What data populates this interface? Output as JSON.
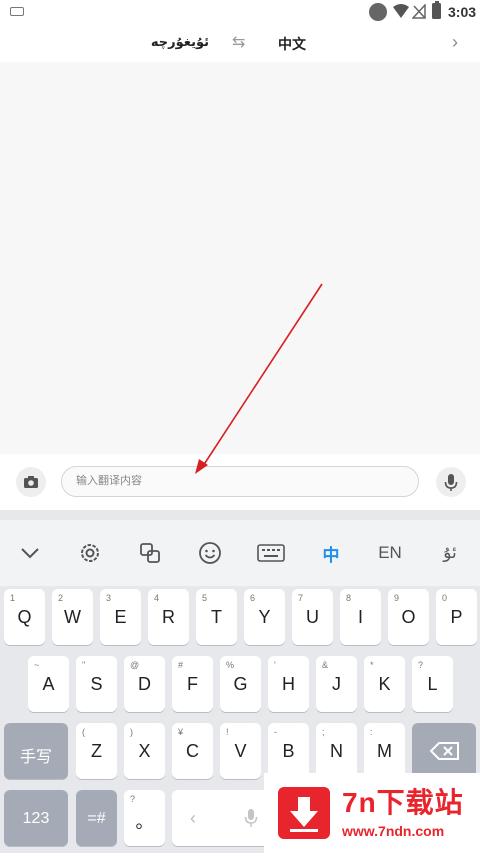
{
  "status_bar": {
    "time": "3:03"
  },
  "header": {
    "source_language": "ئۇيغۇرچە",
    "target_language": "中文",
    "swap_glyph": "⇆",
    "chevron_glyph": "›"
  },
  "input": {
    "placeholder": "输入翻译内容"
  },
  "keyboard": {
    "toolbar": {
      "chinese_label": "中",
      "english_label": "EN",
      "uyghur_label": "ئۇ"
    },
    "row1": [
      {
        "label": "Q",
        "hint": "1"
      },
      {
        "label": "W",
        "hint": "2"
      },
      {
        "label": "E",
        "hint": "3"
      },
      {
        "label": "R",
        "hint": "4"
      },
      {
        "label": "T",
        "hint": "5"
      },
      {
        "label": "Y",
        "hint": "6"
      },
      {
        "label": "U",
        "hint": "7"
      },
      {
        "label": "I",
        "hint": "8"
      },
      {
        "label": "O",
        "hint": "9"
      },
      {
        "label": "P",
        "hint": "0"
      }
    ],
    "row2": [
      {
        "label": "A",
        "hint": "~"
      },
      {
        "label": "S",
        "hint": "\""
      },
      {
        "label": "D",
        "hint": "@"
      },
      {
        "label": "F",
        "hint": "#"
      },
      {
        "label": "G",
        "hint": "%"
      },
      {
        "label": "H",
        "hint": "'"
      },
      {
        "label": "J",
        "hint": "&"
      },
      {
        "label": "K",
        "hint": "*"
      },
      {
        "label": "L",
        "hint": "?"
      }
    ],
    "row3": [
      {
        "label": "Z",
        "hint": "("
      },
      {
        "label": "X",
        "hint": ")"
      },
      {
        "label": "C",
        "hint": "¥"
      },
      {
        "label": "V",
        "hint": "!"
      },
      {
        "label": "B",
        "hint": "-"
      },
      {
        "label": "N",
        "hint": ";"
      },
      {
        "label": "M",
        "hint": ":"
      }
    ],
    "handwrite_label": "手写",
    "num_label": "123",
    "symbol_label": "=#",
    "period_label": "。",
    "period_hint": "?",
    "space_left_glyph": "‹"
  },
  "watermark": {
    "title": "7n下载站",
    "url": "www.7ndn.com",
    "brand_color": "#e8252c"
  },
  "colors": {
    "accent": "#1f8ef1",
    "annotation_arrow": "#d62020"
  }
}
